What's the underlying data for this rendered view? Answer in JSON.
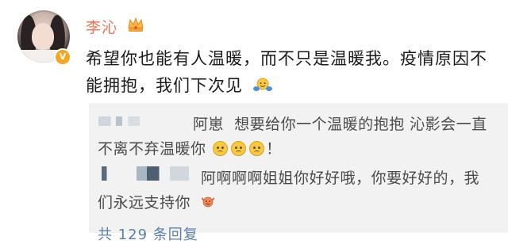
{
  "post": {
    "username": "李沁",
    "crown_icon": "crown-icon",
    "verified_badge": "V",
    "text": "希望你也能有人温暖，而不只是温暖我。疫情原因不能拥抱，我们下次见",
    "text_emoji": "hug-emoji-icon"
  },
  "replies": [
    {
      "name": "阿崽",
      "text": "想要给你一个温暖的抱抱  沁影会一直不离不弃温暖你",
      "emojis": [
        "smile-emoji-icon",
        "smile-emoji-icon",
        "smile-emoji-icon"
      ],
      "suffix": "！"
    },
    {
      "text": "阿啊啊啊姐姐你好好哦，你要好好的，我们永远支持你",
      "emoji": "cheer-emoji-icon"
    }
  ],
  "footer": {
    "total_replies": "共 129 条回复"
  },
  "colors": {
    "username": "#eb7350",
    "reply_bg": "#f2f2f2",
    "link": "#5b7fa8"
  }
}
